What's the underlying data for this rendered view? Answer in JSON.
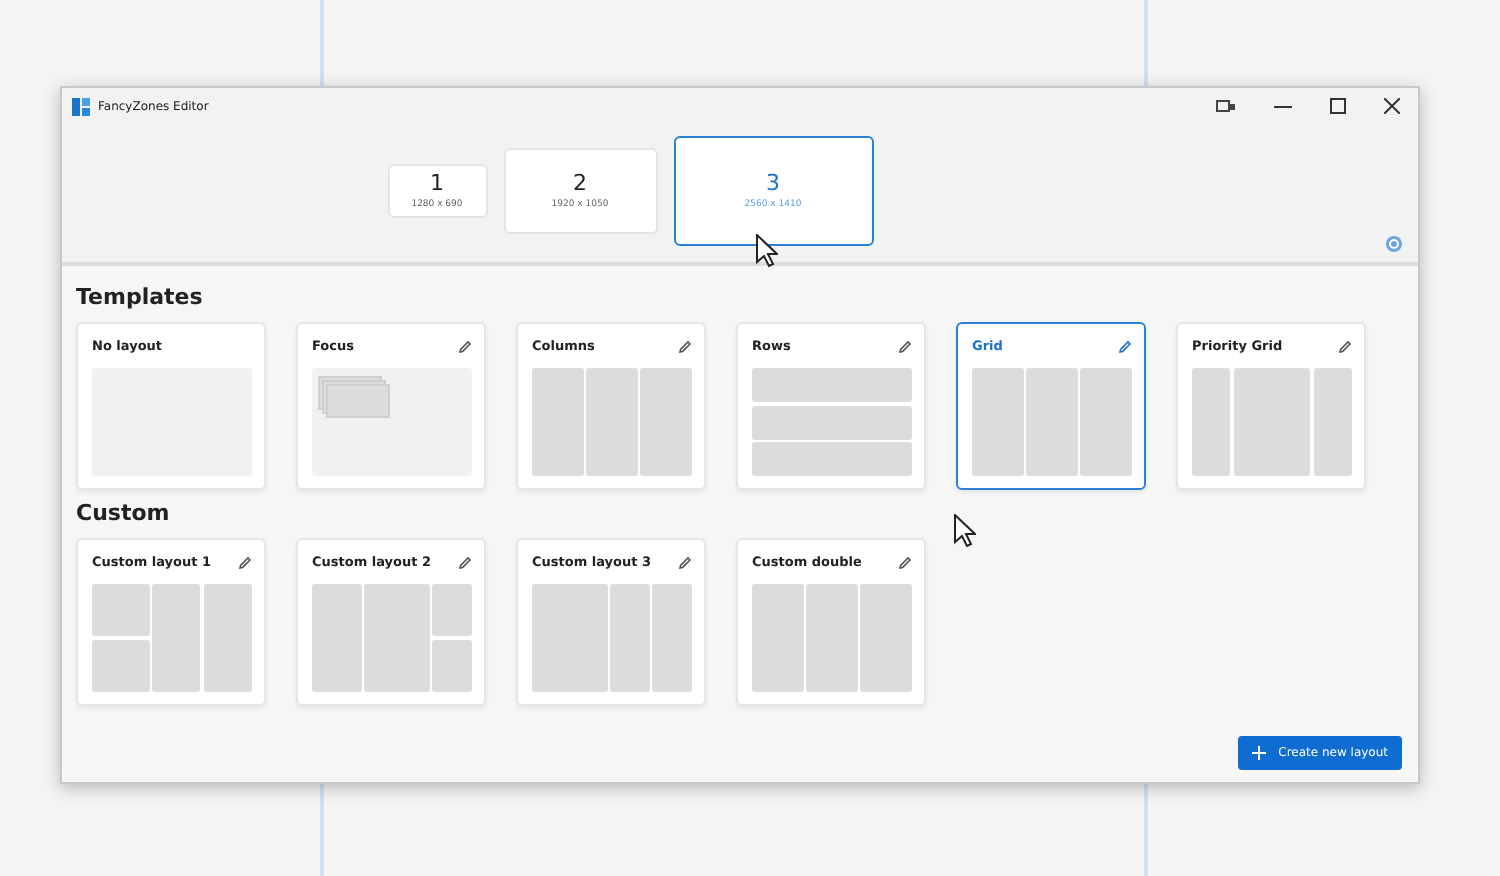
{
  "window": {
    "title": "FancyZones Editor"
  },
  "monitors": [
    {
      "number": "1",
      "resolution": "1280 x 690",
      "selected": false
    },
    {
      "number": "2",
      "resolution": "1920 x 1050",
      "selected": false
    },
    {
      "number": "3",
      "resolution": "2560 x 1410",
      "selected": true
    }
  ],
  "templates": {
    "heading": "Templates",
    "layouts": [
      {
        "name": "No layout",
        "kind": "blank",
        "editable": false,
        "selected": false
      },
      {
        "name": "Focus",
        "kind": "focus",
        "editable": true,
        "selected": false
      },
      {
        "name": "Columns",
        "kind": "columns",
        "editable": true,
        "selected": false
      },
      {
        "name": "Rows",
        "kind": "rows",
        "editable": true,
        "selected": false
      },
      {
        "name": "Grid",
        "kind": "columns",
        "editable": true,
        "selected": true
      },
      {
        "name": "Priority Grid",
        "kind": "priority",
        "editable": true,
        "selected": false
      }
    ]
  },
  "custom": {
    "heading": "Custom",
    "layouts": [
      {
        "name": "Custom layout 1",
        "kind": "split-left",
        "editable": true,
        "selected": false
      },
      {
        "name": "Custom layout 2",
        "kind": "split-right",
        "editable": true,
        "selected": false
      },
      {
        "name": "Custom layout 3",
        "kind": "wide-left",
        "editable": true,
        "selected": false
      },
      {
        "name": "Custom double",
        "kind": "columns",
        "editable": true,
        "selected": false
      }
    ]
  },
  "create_button": {
    "label": "Create new layout"
  }
}
